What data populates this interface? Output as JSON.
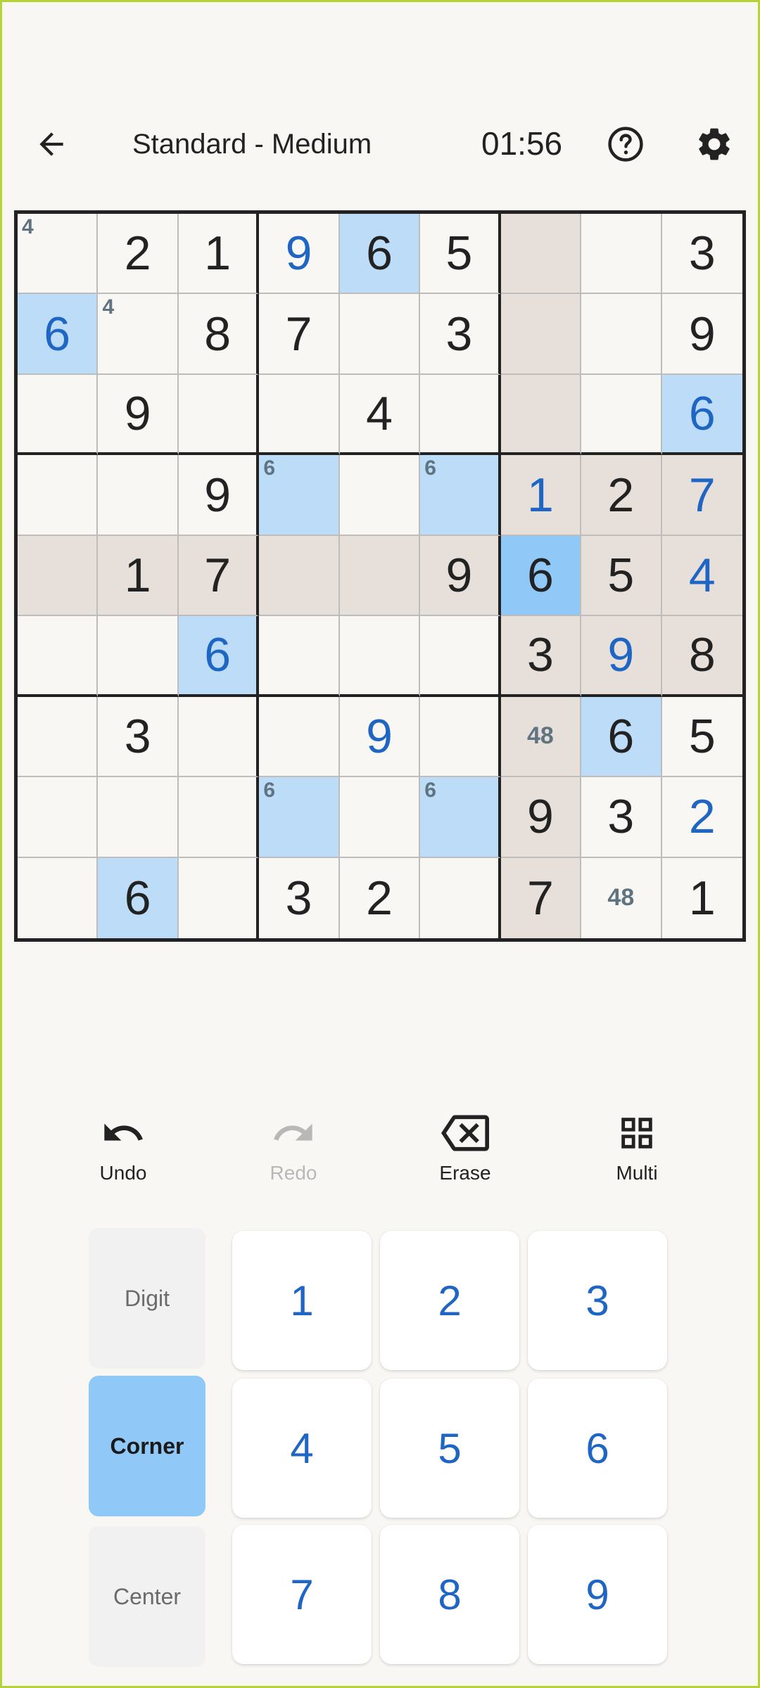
{
  "header": {
    "title": "Standard - Medium",
    "timer": "01:56"
  },
  "grid": {
    "selected": [
      4,
      6
    ],
    "cells": [
      [
        {
          "c": "4"
        },
        {
          "v": "2"
        },
        {
          "v": "1"
        },
        {
          "v": "9",
          "u": true
        },
        {
          "v": "6",
          "s": true
        },
        {
          "v": "5"
        },
        {
          "h": true
        },
        {},
        {
          "v": "3"
        }
      ],
      [
        {
          "v": "6",
          "u": true,
          "s": true
        },
        {
          "c": "4"
        },
        {
          "v": "8"
        },
        {
          "v": "7"
        },
        {},
        {
          "v": "3"
        },
        {
          "h": true
        },
        {},
        {
          "v": "9"
        }
      ],
      [
        {},
        {
          "v": "9"
        },
        {},
        {},
        {
          "v": "4"
        },
        {},
        {
          "h": true
        },
        {},
        {
          "v": "6",
          "u": true,
          "s": true
        }
      ],
      [
        {},
        {},
        {
          "v": "9"
        },
        {
          "c": "6",
          "s": true
        },
        {},
        {
          "c": "6",
          "s": true
        },
        {
          "v": "1",
          "u": true,
          "h": true
        },
        {
          "v": "2",
          "h": true
        },
        {
          "v": "7",
          "u": true,
          "h": true
        }
      ],
      [
        {
          "h": true
        },
        {
          "v": "1",
          "h": true
        },
        {
          "v": "7",
          "h": true
        },
        {
          "h": true
        },
        {
          "h": true
        },
        {
          "v": "9",
          "h": true
        },
        {
          "v": "6",
          "sel": true
        },
        {
          "v": "5",
          "h": true
        },
        {
          "v": "4",
          "u": true,
          "h": true
        }
      ],
      [
        {},
        {},
        {
          "v": "6",
          "u": true,
          "s": true
        },
        {},
        {},
        {},
        {
          "v": "3",
          "h": true
        },
        {
          "v": "9",
          "u": true,
          "h": true
        },
        {
          "v": "8",
          "h": true
        }
      ],
      [
        {},
        {
          "v": "3"
        },
        {},
        {},
        {
          "v": "9",
          "u": true
        },
        {},
        {
          "m": "48",
          "h": true
        },
        {
          "v": "6",
          "s": true
        },
        {
          "v": "5"
        }
      ],
      [
        {},
        {},
        {},
        {
          "c": "6",
          "s": true
        },
        {},
        {
          "c": "6",
          "s": true
        },
        {
          "v": "9",
          "h": true
        },
        {
          "v": "3"
        },
        {
          "v": "2",
          "u": true
        }
      ],
      [
        {},
        {
          "v": "6",
          "s": true
        },
        {},
        {
          "v": "3"
        },
        {
          "v": "2"
        },
        {},
        {
          "v": "7",
          "h": true
        },
        {
          "m": "48"
        },
        {
          "v": "1"
        }
      ]
    ]
  },
  "toolbar": {
    "undo": "Undo",
    "redo": "Redo",
    "erase": "Erase",
    "multi": "Multi"
  },
  "modes": {
    "digit": "Digit",
    "corner": "Corner",
    "center": "Center",
    "active": "corner"
  },
  "numpad": [
    "1",
    "2",
    "3",
    "4",
    "5",
    "6",
    "7",
    "8",
    "9"
  ],
  "colors": {
    "given": "#222222",
    "user_digit": "#1f66c4",
    "peer_highlight": "#e6dfda",
    "same_digit": "#bcdcf8",
    "selected": "#90c8f8",
    "mode_active": "#90c8f8"
  }
}
